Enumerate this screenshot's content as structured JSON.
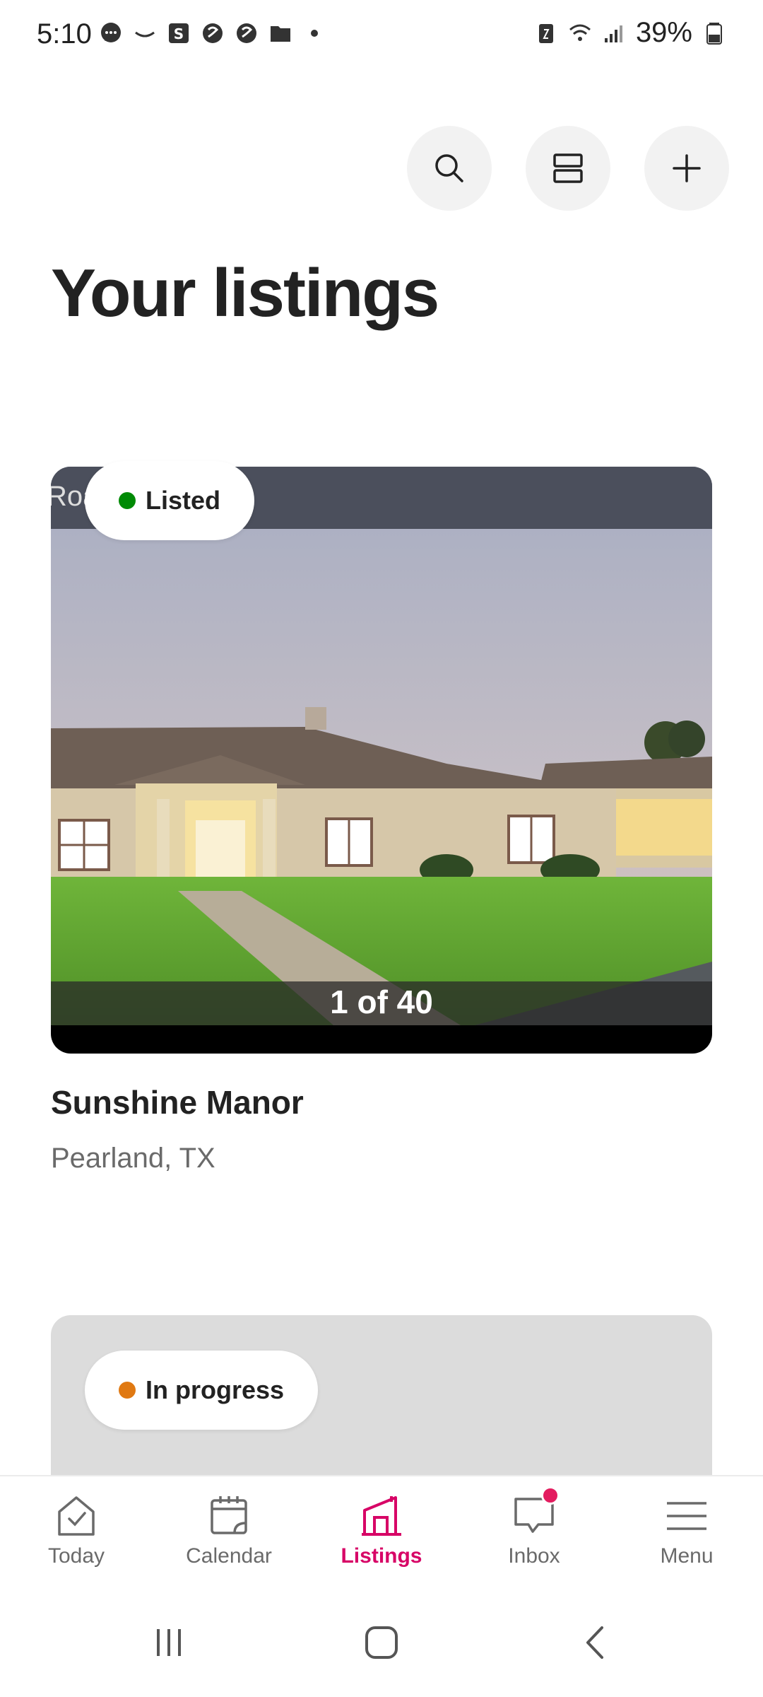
{
  "status_bar": {
    "time": "5:10",
    "battery": "39%"
  },
  "top_actions": {
    "icons": [
      "search-icon",
      "view-toggle-icon",
      "plus-icon"
    ]
  },
  "page": {
    "title": "Your listings"
  },
  "listings": [
    {
      "status": "Listed",
      "status_color": "#008a05",
      "photo_overlay_text": "Roa",
      "photo_counter": "1 of 40",
      "name": "Sunshine Manor",
      "location": "Pearland, TX"
    },
    {
      "status": "In progress",
      "status_color": "#e07912"
    }
  ],
  "bottom_nav": {
    "items": [
      {
        "label": "Today",
        "icon": "today-icon"
      },
      {
        "label": "Calendar",
        "icon": "calendar-icon"
      },
      {
        "label": "Listings",
        "icon": "listings-icon",
        "active": true
      },
      {
        "label": "Inbox",
        "icon": "inbox-icon",
        "badge": true
      },
      {
        "label": "Menu",
        "icon": "menu-icon"
      }
    ],
    "active_color": "#d70466"
  }
}
